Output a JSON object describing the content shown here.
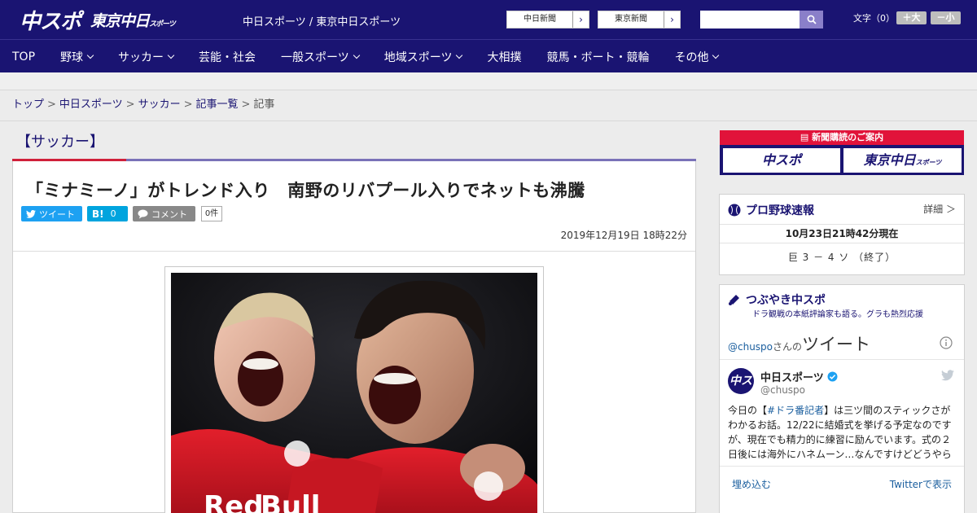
{
  "header": {
    "logo_main": "中スポ",
    "logo_sub": "東京中日",
    "logo_sub_small": "スポーツ",
    "site_name": "中日スポーツ / 東京中日スポーツ",
    "ext_links": [
      "中日新聞",
      "東京新聞"
    ],
    "font_label": "文字（0）",
    "font_up": "＋大",
    "font_down": "－小"
  },
  "nav": {
    "items": [
      {
        "label": "TOP",
        "has_menu": false
      },
      {
        "label": "野球",
        "has_menu": true
      },
      {
        "label": "サッカー",
        "has_menu": true
      },
      {
        "label": "芸能・社会",
        "has_menu": false
      },
      {
        "label": "一般スポーツ",
        "has_menu": true
      },
      {
        "label": "地域スポーツ",
        "has_menu": true
      },
      {
        "label": "大相撲",
        "has_menu": false
      },
      {
        "label": "競馬・ボート・競輪",
        "has_menu": false
      },
      {
        "label": "その他",
        "has_menu": true
      }
    ]
  },
  "breadcrumb": {
    "links": [
      "トップ",
      "中日スポーツ",
      "サッカー",
      "記事一覧"
    ],
    "current": "記事",
    "sep": ">"
  },
  "section": {
    "label": "【サッカー】"
  },
  "article": {
    "title": "「ミナミーノ」がトレンド入り　南野のリバプール入りでネットも沸騰",
    "tweet_label": "ツイート",
    "hatena_label": "B!",
    "hatena_count": "0",
    "comment_label": "コメント",
    "comment_count": "0件",
    "date": "2019年12月19日 18時22分"
  },
  "sidebar": {
    "subscribe_title": "新聞購読のご案内",
    "subscribe_left": "中スポ",
    "subscribe_right": "東京中日",
    "subscribe_right_small": "スポーツ",
    "baseball": {
      "title": "プロ野球速報",
      "detail": "詳細 ＞",
      "updated": "10月23日21時42分現在",
      "score": "巨 3 － 4 ソ （終了）"
    },
    "tsubuyaki": {
      "title": "つぶやき中スポ",
      "subtitle": "ドラ観戦の本紙評論家も語る。グラも熱烈応援"
    },
    "twitter": {
      "handle_prefix": "@chuspo",
      "handle_suffix": "さんの",
      "heading": "ツイート",
      "account_name": "中日スポーツ",
      "account_handle": "@chuspo",
      "tweet_text_1": "今日の【",
      "hashtag": "#ドラ番記者",
      "tweet_text_2": "】は三ツ間のスティックさがわかるお話。12/22に結婚式を挙げる予定なのですが、現在でも精力的に練習に励んでいます。式の２日後には海外にハネムーン…なんですけどどうやら",
      "embed": "埋め込む",
      "view_on": "Twitterで表示"
    }
  },
  "colors": {
    "brand": "#1a1472",
    "accent_red": "#d0203a",
    "twitter_blue": "#1da1f2",
    "hatena_blue": "#00a4de"
  }
}
